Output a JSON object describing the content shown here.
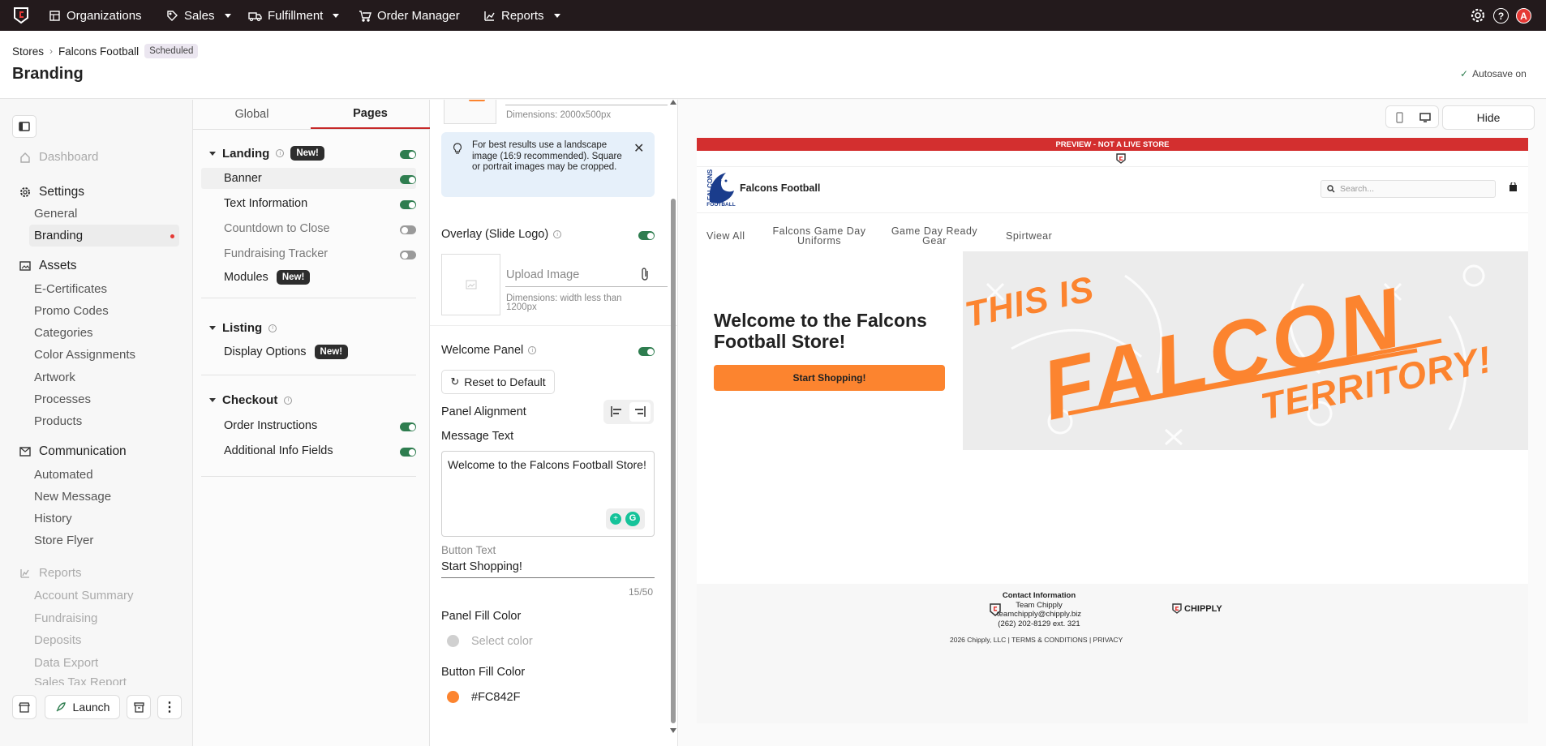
{
  "topnav": {
    "items": [
      {
        "label": "Organizations",
        "icon": "building-icon"
      },
      {
        "label": "Sales",
        "icon": "tag-icon"
      },
      {
        "label": "Fulfillment",
        "icon": "truck-icon"
      },
      {
        "label": "Order Manager",
        "icon": "cart-icon"
      },
      {
        "label": "Reports",
        "icon": "chart-icon"
      }
    ],
    "avatar_letter": "A",
    "help_glyph": "?"
  },
  "breadcrumb": {
    "root": "Stores",
    "store": "Falcons Football",
    "status": "Scheduled"
  },
  "page": {
    "title": "Branding",
    "autosave": "Autosave on"
  },
  "sidebar": {
    "dashboard": "Dashboard",
    "settings": {
      "label": "Settings",
      "items": [
        "General",
        "Branding"
      ]
    },
    "assets": {
      "label": "Assets",
      "items": [
        "E-Certificates",
        "Promo Codes",
        "Categories",
        "Color Assignments",
        "Artwork",
        "Processes",
        "Products"
      ]
    },
    "communication": {
      "label": "Communication",
      "items": [
        "Automated",
        "New Message",
        "History",
        "Store Flyer"
      ]
    },
    "reports": {
      "label": "Reports",
      "items": [
        "Account Summary",
        "Fundraising",
        "Deposits",
        "Data Export",
        "Sales Tax Report"
      ]
    },
    "footer": {
      "launch": "Launch"
    }
  },
  "tabs": {
    "global": "Global",
    "pages": "Pages"
  },
  "sections": {
    "landing": {
      "label": "Landing",
      "badge": "New!",
      "items": [
        "Banner",
        "Text Information",
        "Countdown to Close",
        "Fundraising Tracker",
        "Modules"
      ],
      "modules_badge": "New!"
    },
    "listing": {
      "label": "Listing",
      "items": [
        "Display Options"
      ],
      "badge": "New!"
    },
    "checkout": {
      "label": "Checkout",
      "items": [
        "Order Instructions",
        "Additional Info Fields"
      ]
    }
  },
  "settings_panel": {
    "banner_dimensions": "Dimensions: 2000x500px",
    "tip": "For best results use a landscape image (16:9 recommended). Square or portrait images may be cropped.",
    "overlay_label": "Overlay (Slide Logo)",
    "upload_label": "Upload Image",
    "overlay_dimensions": "Dimensions: width less than 1200px",
    "welcome_label": "Welcome Panel",
    "reset_label": "Reset to Default",
    "alignment_label": "Panel Alignment",
    "message_label": "Message Text",
    "message_value": "Welcome to the Falcons Football Store!",
    "button_text_label": "Button Text",
    "button_text_value": "Start Shopping!",
    "char_count": "15/50",
    "panel_fill_label": "Panel Fill Color",
    "panel_fill_placeholder": "Select color",
    "button_fill_label": "Button Fill Color",
    "button_fill_value": "#FC842F"
  },
  "preview": {
    "hide_label": "Hide",
    "banner": "PREVIEW - NOT A LIVE STORE",
    "store_name": "Falcons Football",
    "logo_text": "FALCONS",
    "logo_sub": "FOOTBALL",
    "search_placeholder": "Search...",
    "nav": [
      "View All",
      "Falcons Game Day Uniforms",
      "Game Day Ready Gear",
      "Spirtwear"
    ],
    "welcome": "Welcome to the Falcons Football Store!",
    "cta": "Start Shopping!",
    "hero": {
      "line1": "THIS IS",
      "line2": "FALCON",
      "line3": "TERRITORY!"
    },
    "footer": {
      "contact_title": "Contact Information",
      "team": "Team Chipply",
      "email": "teamchipply@chipply.biz",
      "phone": "(262) 202-8129 ext. 321",
      "brand": "CHIPPLY",
      "copyright": "2026 Chipply, LLC",
      "terms": "TERMS & CONDITIONS",
      "privacy": "PRIVACY"
    }
  },
  "colors": {
    "topbar": "#231a1c",
    "accent": "#FC842F",
    "toggle_on": "#2e7d4f",
    "preview_banner": "#d32f2f",
    "tip_bg": "#e6f0fa"
  }
}
